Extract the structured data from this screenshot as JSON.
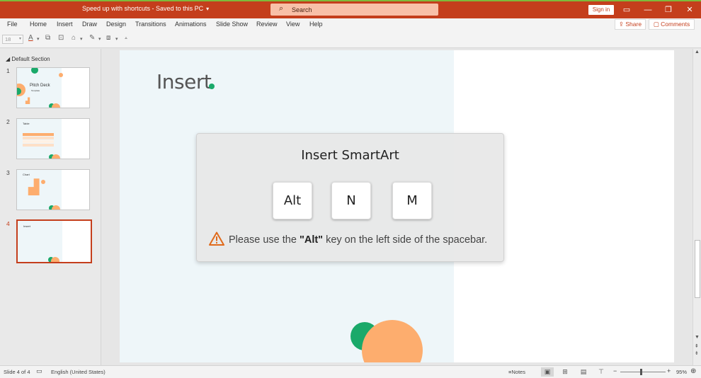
{
  "titlebar": {
    "doc_title": "Speed up with shortcuts - Saved to this PC",
    "caret": "▾",
    "search_placeholder": "Search",
    "signin_label": "Sign in",
    "ribbon_icon": "▭",
    "minimize_icon": "—",
    "restore_icon": "❐",
    "close_icon": "✕"
  },
  "menubar": {
    "items": [
      "File",
      "Home",
      "Insert",
      "Draw",
      "Design",
      "Transitions",
      "Animations",
      "Slide Show",
      "Review",
      "View",
      "Help"
    ],
    "share_label": "Share",
    "comments_label": "Comments"
  },
  "toolbar": {
    "font_size_value": "18"
  },
  "thumbnails": {
    "section_title": "Default Section",
    "slides": [
      {
        "number": "1",
        "title": "Pitch Deck",
        "subtitle": "Template"
      },
      {
        "number": "2",
        "title": "Table"
      },
      {
        "number": "3",
        "title": "Chart"
      },
      {
        "number": "4",
        "title": "Insert"
      }
    ],
    "active_slide": 4
  },
  "slide": {
    "title": "Insert"
  },
  "overlay": {
    "title": "Insert SmartArt",
    "keys": [
      "Alt",
      "N",
      "M"
    ],
    "warning_prefix": "Please use the ",
    "warning_key": "\"Alt\"",
    "warning_suffix": " key on the left side of the spacebar."
  },
  "statusbar": {
    "slide_info": "Slide 4 of 4",
    "language": "English (United States)",
    "notes_label": "Notes",
    "zoom_minus": "−",
    "zoom_plus": "+",
    "zoom_value": "95%"
  },
  "colors": {
    "brand": "#c43e1c",
    "accent_green": "#1aa96a",
    "accent_orange": "#fdad6e",
    "warning": "#e06a1b"
  }
}
